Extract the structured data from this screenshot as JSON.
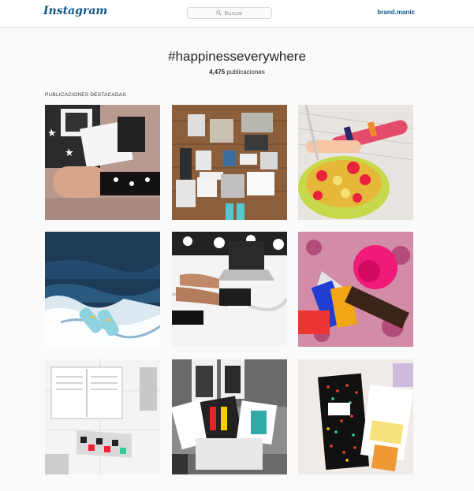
{
  "header": {
    "logo": "Instagram",
    "search_placeholder": "Buscar",
    "username": "brand.manic"
  },
  "tag": {
    "title": "#happinesseverywhere",
    "count": "4,475",
    "count_label": "publicaciones"
  },
  "featured": {
    "heading": "PUBLICACIONES DESTACADAS",
    "posts": [
      {
        "id": "post-1",
        "icon": "socks-box-photo"
      },
      {
        "id": "post-2",
        "icon": "flatlay-photo"
      },
      {
        "id": "post-3",
        "icon": "fruit-bowl-photo"
      },
      {
        "id": "post-4",
        "icon": "ocean-photo"
      },
      {
        "id": "post-5",
        "icon": "laptop-bed-photo"
      },
      {
        "id": "post-6",
        "icon": "pink-pillow-photo"
      },
      {
        "id": "post-7",
        "icon": "book-photo"
      },
      {
        "id": "post-8",
        "icon": "sock-packages-photo"
      },
      {
        "id": "post-9",
        "icon": "notebook-photo"
      }
    ]
  },
  "colors": {
    "brand_blue": "#125688",
    "page_bg": "#fafafa"
  }
}
